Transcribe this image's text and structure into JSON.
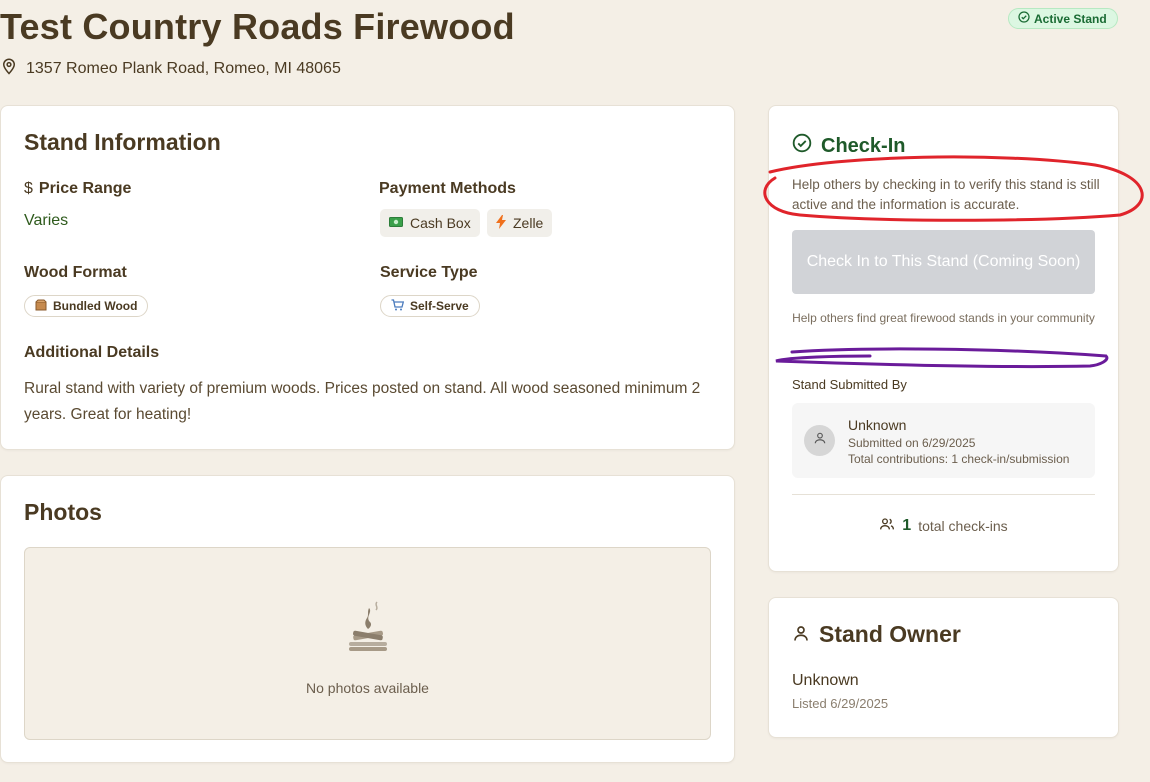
{
  "header": {
    "title": "Test Country Roads Firewood",
    "address": "1357 Romeo Plank Road, Romeo, MI 48065",
    "status_badge": "Active Stand"
  },
  "stand_info": {
    "heading": "Stand Information",
    "price_range_label": "Price Range",
    "price_range_value": "Varies",
    "payment_methods_label": "Payment Methods",
    "payment_methods": [
      {
        "label": "Cash Box",
        "icon": "money-icon"
      },
      {
        "label": "Zelle",
        "icon": "lightning-icon"
      }
    ],
    "wood_format_label": "Wood Format",
    "wood_format_value": "Bundled Wood",
    "service_type_label": "Service Type",
    "service_type_value": "Self-Serve",
    "details_label": "Additional Details",
    "details_text": "Rural stand with variety of premium woods. Prices posted on stand. All wood seasoned minimum 2 years. Great for heating!"
  },
  "photos": {
    "heading": "Photos",
    "empty_text": "No photos available"
  },
  "checkin": {
    "heading": "Check-In",
    "help_text": "Help others by checking in to verify this stand is still active and the information is accurate.",
    "button_label": "Check In to This Stand (Coming Soon)",
    "help_small": "Help others find great firewood stands in your community",
    "submitted_by_label": "Stand Submitted By",
    "submitter_name": "Unknown",
    "submitted_on": "Submitted on 6/29/2025",
    "contributions": "Total contributions: 1 check-in/submission",
    "total_checkins_count": "1",
    "total_checkins_label": "total check-ins"
  },
  "owner": {
    "heading": "Stand Owner",
    "name": "Unknown",
    "listed": "Listed 6/29/2025"
  },
  "colors": {
    "background": "#f4efe6",
    "primary_text": "#4a3a22",
    "accent_green": "#1f5a2a",
    "badge_bg": "#dcf7e2",
    "annotation_red": "#e0242b",
    "annotation_purple": "#6a1b9a"
  }
}
